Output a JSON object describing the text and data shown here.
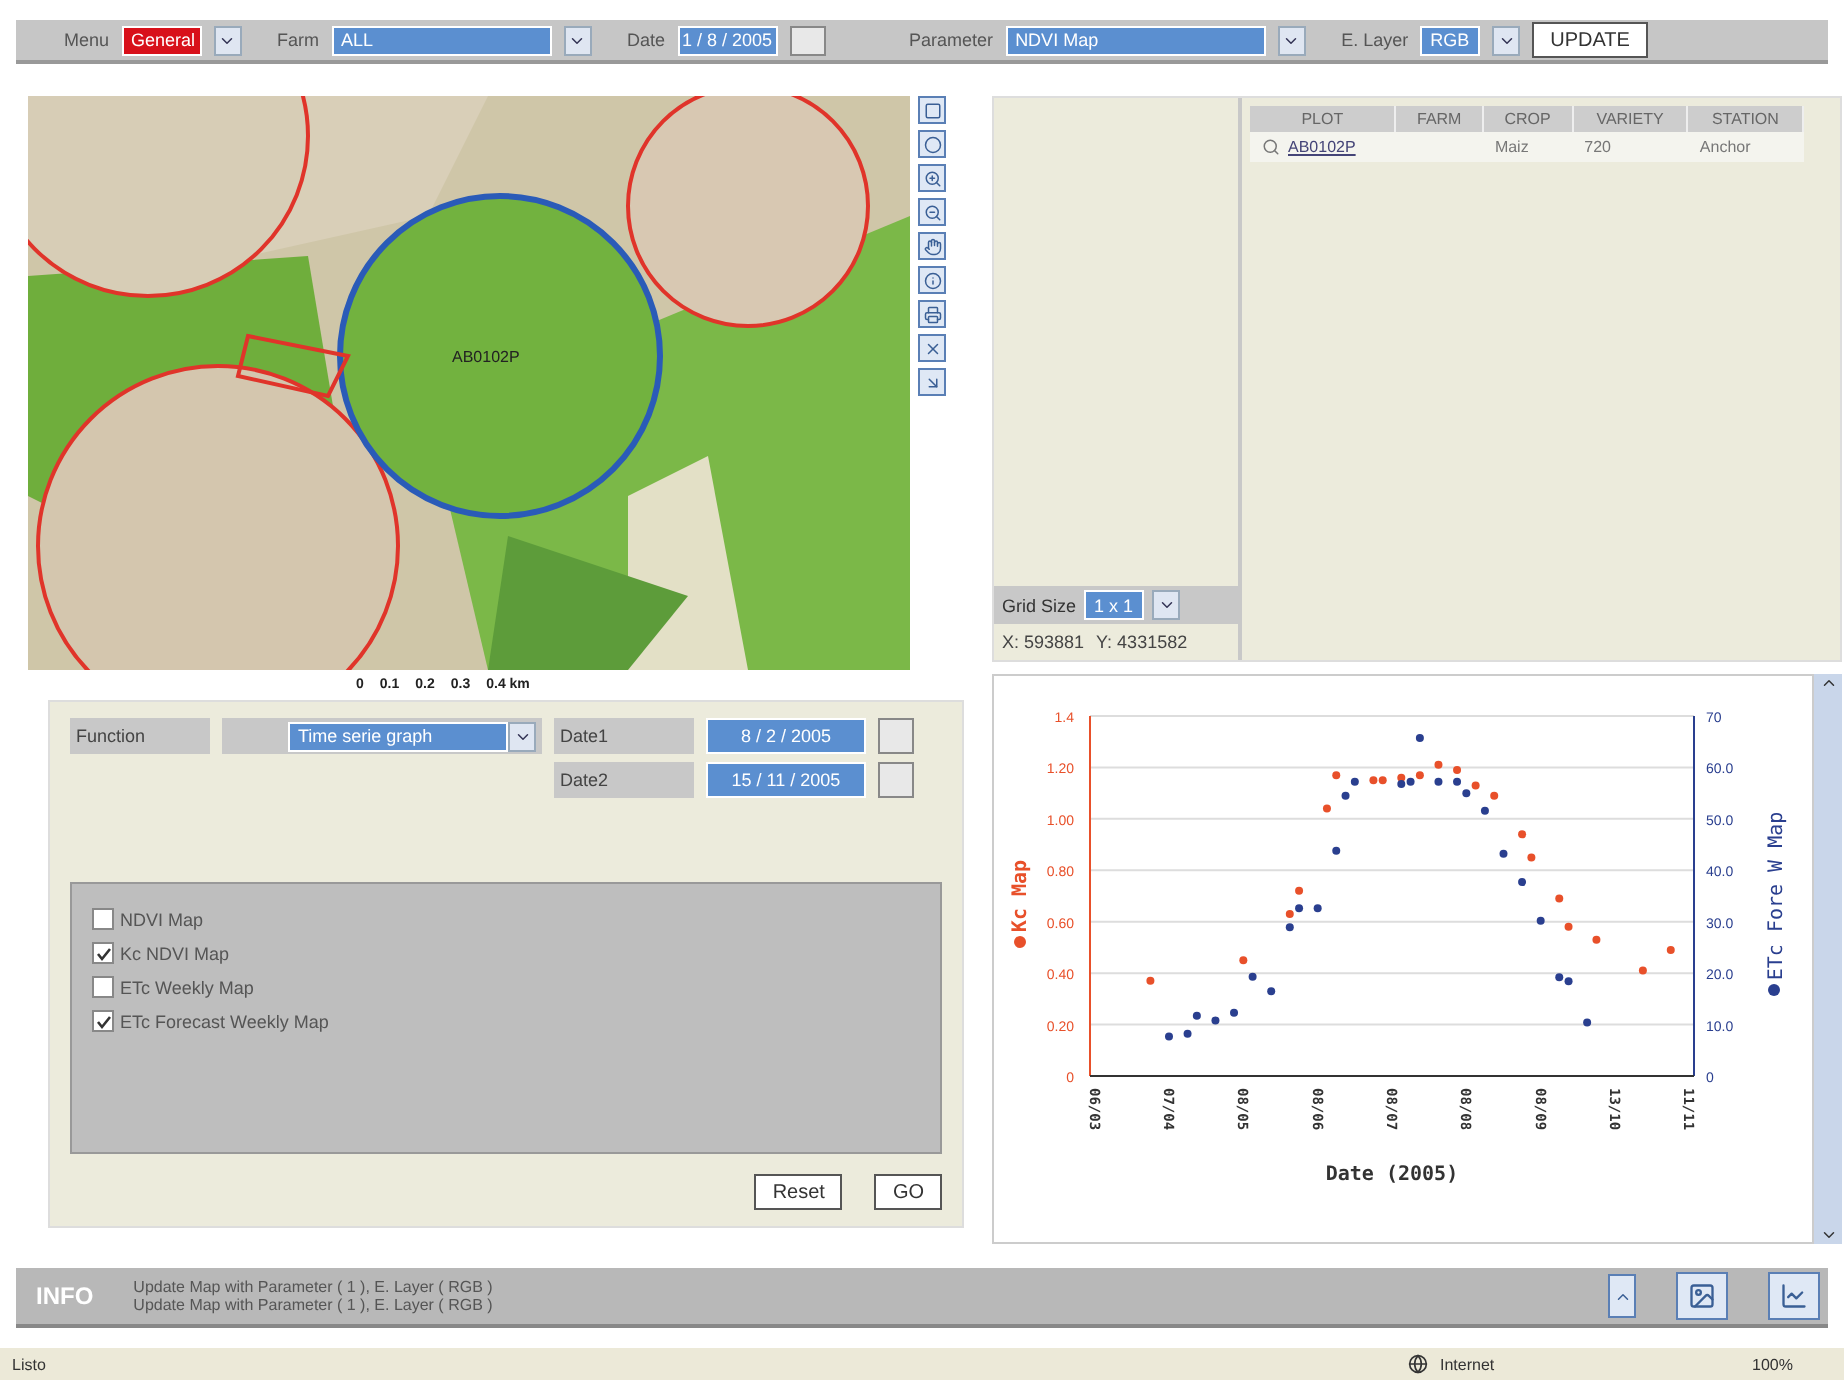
{
  "toolbar": {
    "fields": [
      {
        "label": "Menu",
        "value": "General",
        "kind": "select",
        "highlight": true
      },
      {
        "label": "Farm",
        "value": "ALL",
        "kind": "select",
        "highlight": false
      },
      {
        "label": "Date",
        "value": "1 / 8 / 2005",
        "kind": "date",
        "highlight": false
      },
      {
        "label": "Parameter",
        "value": "NDVI Map",
        "kind": "select",
        "highlight": false
      },
      {
        "label": "E. Layer",
        "value": "RGB",
        "kind": "select",
        "highlight": false
      }
    ],
    "button": "UPDATE"
  },
  "map": {
    "plot_label": "AB0102P",
    "scale": [
      "0",
      "0.1",
      "0.2",
      "0.3",
      "0.4 km"
    ]
  },
  "plots_table": {
    "columns": [
      "PLOT",
      "FARM",
      "CROP",
      "VARIETY",
      "STATION"
    ],
    "rows": [
      {
        "cells": [
          "AB0102P",
          "",
          "Maiz",
          "720",
          "Anchor"
        ]
      }
    ]
  },
  "grid": {
    "label": "Grid Size",
    "value": "1 x 1",
    "x": "X: 593881",
    "y": "Y: 4331582"
  },
  "function_panel": {
    "function_label": "Function",
    "function_value": "Time serie graph",
    "dates": [
      {
        "label": "Date1",
        "value": "8 / 2 / 2005"
      },
      {
        "label": "Date2",
        "value": "15 / 11 / 2005"
      }
    ],
    "layers": [
      {
        "label": "NDVI Map",
        "checked": false
      },
      {
        "label": "Kc NDVI Map",
        "checked": true
      },
      {
        "label": "ETc Weekly Map",
        "checked": false
      },
      {
        "label": "ETc Forecast Weekly Map",
        "checked": true
      }
    ],
    "buttons": [
      "Reset",
      "GO"
    ]
  },
  "chart": {
    "chart_data": {
      "type": "scatter",
      "xlabel": "Date (2005)",
      "grid": true,
      "ylim": [
        0,
        1.4
      ],
      "y2lim": [
        0,
        70
      ],
      "categories": [
        "06/03",
        null,
        null,
        null,
        null,
        null,
        null,
        null,
        "07/04",
        null,
        null,
        null,
        null,
        null,
        null,
        null,
        "08/05",
        null,
        null,
        null,
        null,
        null,
        null,
        null,
        "08/06",
        null,
        null,
        null,
        null,
        null,
        null,
        null,
        "08/07",
        null,
        null,
        null,
        null,
        null,
        null,
        null,
        "08/08",
        null,
        null,
        null,
        null,
        null,
        null,
        null,
        "08/09",
        null,
        null,
        null,
        null,
        null,
        null,
        null,
        "13/10",
        null,
        null,
        null,
        null,
        null,
        null,
        null,
        "11/11"
      ],
      "yticks": [
        {
          "value": 0,
          "label": "0"
        },
        {
          "value": 0.2,
          "label": "0.20"
        },
        {
          "value": 0.4,
          "label": "0.40"
        },
        {
          "value": 0.6,
          "label": "0.60"
        },
        {
          "value": 0.8,
          "label": "0.80"
        },
        {
          "value": 1.0,
          "label": "1.00"
        },
        {
          "value": 1.2,
          "label": "1.20"
        },
        {
          "value": 1.4,
          "label": "1.4"
        }
      ],
      "y2ticks": [
        {
          "value": 0,
          "label": "0"
        },
        {
          "value": 10,
          "label": "10.0"
        },
        {
          "value": 20,
          "label": "20.0"
        },
        {
          "value": 30,
          "label": "30.0"
        },
        {
          "value": 40,
          "label": "40.0"
        },
        {
          "value": 50,
          "label": "50.0"
        },
        {
          "value": 60,
          "label": "60.0"
        },
        {
          "value": 70,
          "label": "70"
        }
      ],
      "series": [
        {
          "name": "Kc Map",
          "color": "#e8502a",
          "values": [
            null,
            null,
            null,
            null,
            null,
            null,
            0.37,
            null,
            null,
            null,
            null,
            null,
            null,
            null,
            null,
            null,
            0.45,
            null,
            null,
            null,
            null,
            0.63,
            0.72,
            null,
            null,
            1.04,
            1.17,
            null,
            null,
            null,
            1.15,
            1.15,
            null,
            1.16,
            null,
            1.17,
            null,
            1.21,
            null,
            1.19,
            null,
            1.13,
            null,
            1.09,
            null,
            null,
            0.94,
            0.85,
            null,
            null,
            0.69,
            0.58,
            null,
            null,
            0.53,
            null,
            null,
            null,
            null,
            0.41,
            null,
            null,
            0.49,
            null,
            null
          ]
        },
        {
          "name": "ETc Fore W Map",
          "color": "#2a3f8f",
          "axis": "y2",
          "values": [
            null,
            null,
            null,
            null,
            null,
            null,
            null,
            null,
            7.7,
            null,
            8.2,
            11.7,
            null,
            10.8,
            null,
            12.3,
            null,
            19.3,
            null,
            16.5,
            null,
            28.9,
            32.6,
            null,
            32.6,
            null,
            43.8,
            54.5,
            57.2,
            null,
            null,
            null,
            null,
            56.8,
            57.2,
            65.7,
            null,
            57.2,
            null,
            57.2,
            55.0,
            null,
            51.6,
            null,
            43.2,
            null,
            37.7,
            null,
            30.2,
            null,
            19.2,
            18.4,
            null,
            10.4,
            null,
            null,
            null,
            null,
            null,
            null,
            null,
            null,
            null,
            null,
            null
          ]
        }
      ]
    }
  },
  "info": {
    "title": "INFO",
    "messages": [
      "Update Map with Parameter ( 1 ), E. Layer ( RGB )",
      "Update Map with Parameter ( 1 ), E. Layer ( RGB )"
    ]
  },
  "status_bar": {
    "text": "Listo",
    "zone": "Internet",
    "zoom": "100%"
  }
}
